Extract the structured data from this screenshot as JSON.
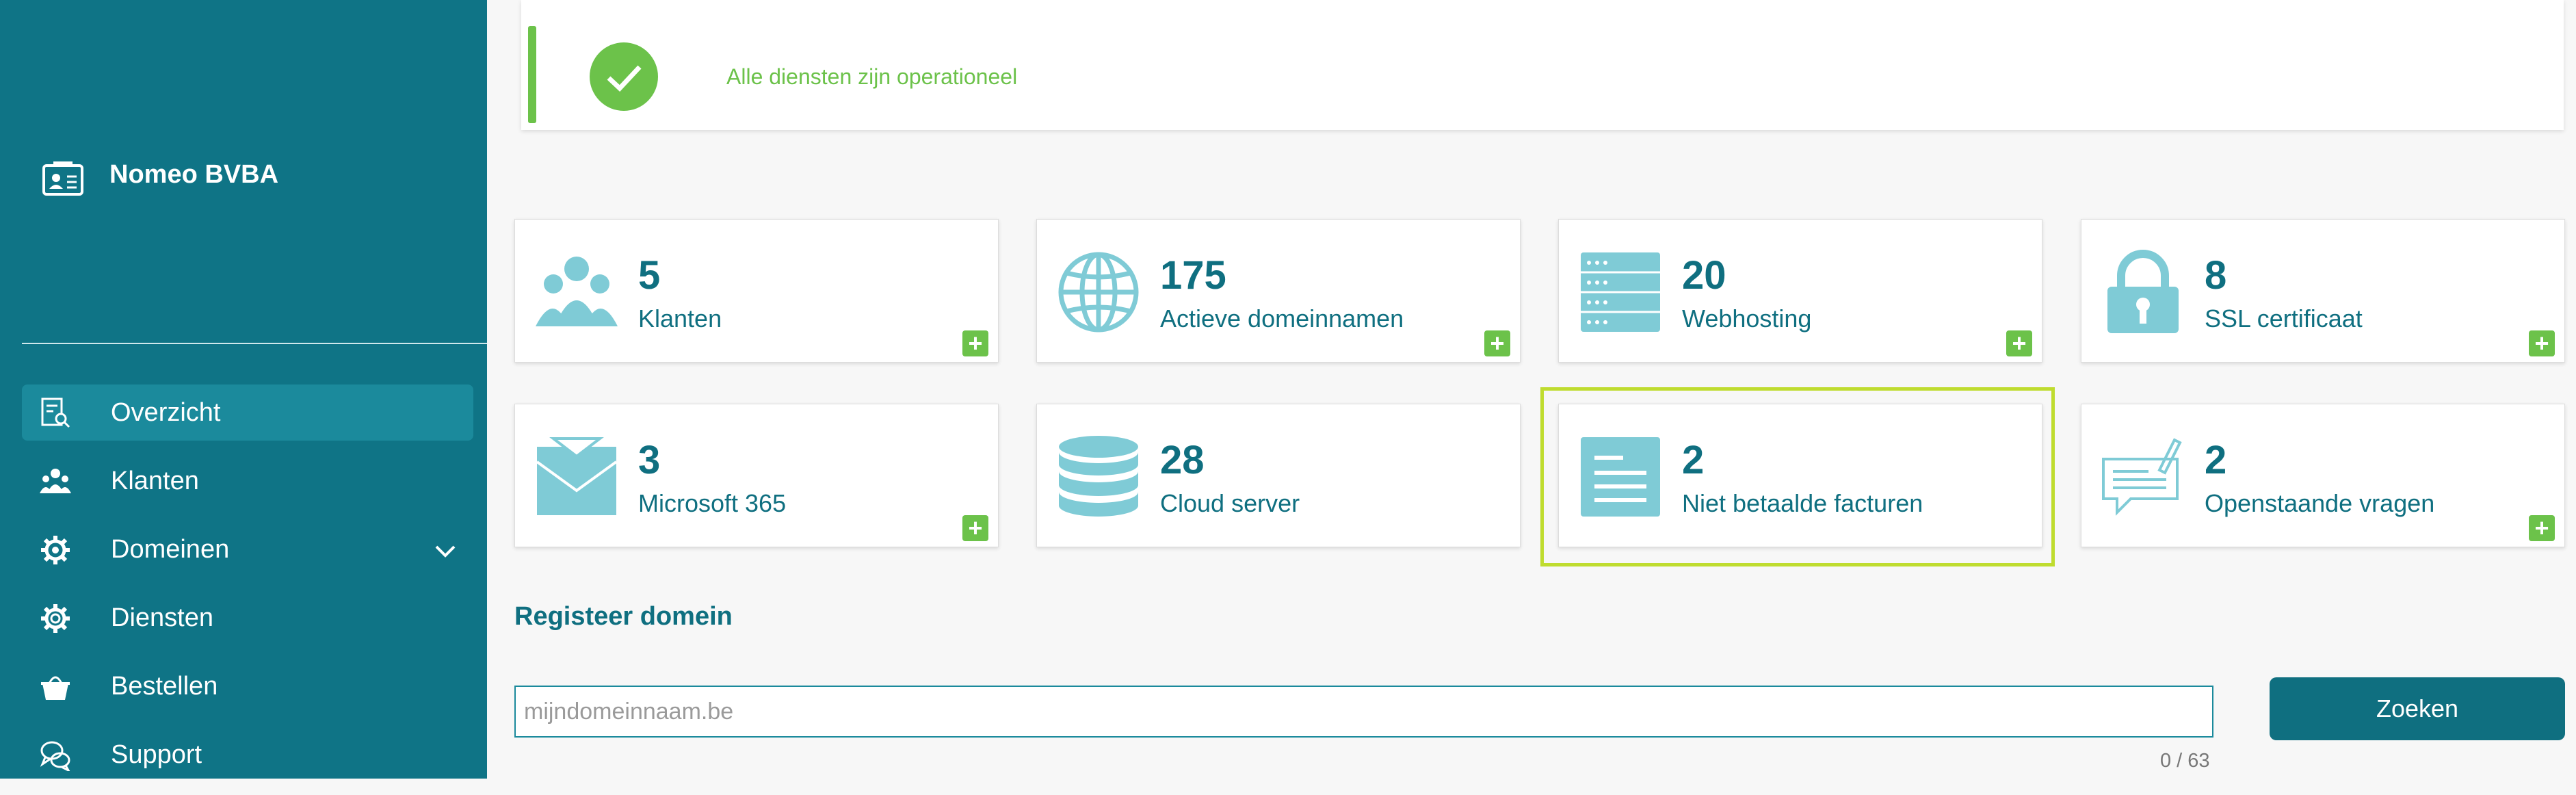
{
  "company": {
    "name": "Nomeo BVBA",
    "icon": "id-card-icon"
  },
  "nav": [
    {
      "label": "Overzicht",
      "icon": "overview-icon",
      "active": true
    },
    {
      "label": "Klanten",
      "icon": "users-icon"
    },
    {
      "label": "Domeinen",
      "icon": "gear-icon",
      "has_submenu": true
    },
    {
      "label": "Diensten",
      "icon": "settings-icon"
    },
    {
      "label": "Bestellen",
      "icon": "basket-icon"
    },
    {
      "label": "Support",
      "icon": "chat-icon"
    }
  ],
  "status": {
    "text": "Alle diensten zijn operationeel",
    "icon": "check-circle-icon",
    "color": "#6cc24a"
  },
  "cards": [
    {
      "number": "5",
      "label": "Klanten",
      "icon": "people-icon",
      "has_add": true
    },
    {
      "number": "175",
      "label": "Actieve domeinnamen",
      "icon": "globe-icon",
      "has_add": true
    },
    {
      "number": "20",
      "label": "Webhosting",
      "icon": "server-icon",
      "has_add": true
    },
    {
      "number": "8",
      "label": "SSL certificaat",
      "icon": "lock-icon",
      "has_add": true
    },
    {
      "number": "3",
      "label": "Microsoft 365",
      "icon": "envelope-icon",
      "has_add": true
    },
    {
      "number": "28",
      "label": "Cloud server",
      "icon": "database-icon",
      "has_add": false
    },
    {
      "number": "2",
      "label": "Niet betaalde facturen",
      "icon": "invoice-icon",
      "has_add": false,
      "highlighted": true
    },
    {
      "number": "2",
      "label": "Openstaande vragen",
      "icon": "question-form-icon",
      "has_add": true
    }
  ],
  "register": {
    "title": "Registeer domein",
    "placeholder": "mijndomeinnaam.be",
    "counter": "0 / 63",
    "button": "Zoeken"
  },
  "colors": {
    "sidebar": "#0f7486",
    "accent": "#0f6f80",
    "icon": "#7fcbd6",
    "add": "#6cc24a",
    "highlight": "#bfdc2f"
  }
}
